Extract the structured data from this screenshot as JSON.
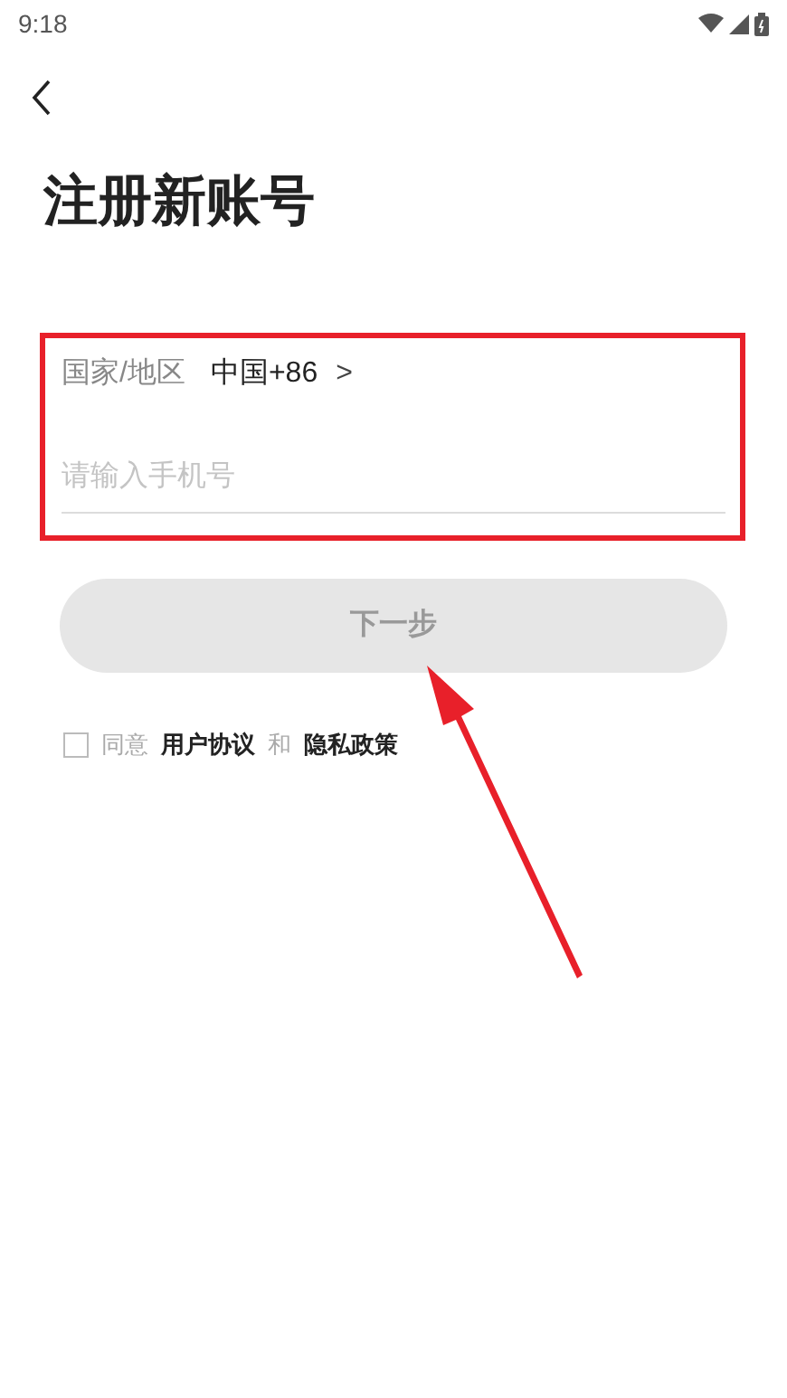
{
  "status_bar": {
    "time": "9:18"
  },
  "title": "注册新账号",
  "form": {
    "region_label": "国家/地区",
    "region_value": "中国+86",
    "region_chevron": ">",
    "phone_placeholder": "请输入手机号"
  },
  "next_button": {
    "label": "下一步",
    "disabled": true
  },
  "agreement": {
    "checked": false,
    "prefix": "同意",
    "link_1": "用户协议",
    "joiner": "和",
    "link_2": "隐私政策"
  }
}
